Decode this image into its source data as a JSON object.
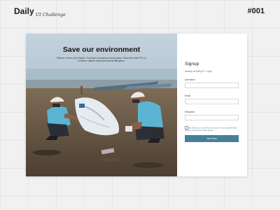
{
  "header": {
    "brand": "Daily",
    "brand_sub": "UI Challenge",
    "issue": "#001"
  },
  "hero": {
    "title": "Save our environment",
    "text": "Reduce, reuse, and recycle. Cut down on what you throw away. Follow the three 'R's' to conserve natural resources and landfill space."
  },
  "signup": {
    "title": "Signup",
    "already_text": "Already on Daily UI ?",
    "login_link": "Login",
    "fields": {
      "username": "Username",
      "email": "Email",
      "password": "Password"
    },
    "terms_prefix": "By clicking on Join Now you agree to our ",
    "terms_link": "agreements, privacy policy and cookie policy",
    "terms_suffix": ".",
    "join_label": "Join Now"
  },
  "colors": {
    "accent": "#477f9b",
    "link": "#3f7fa3",
    "page_bg": "#f1f1f1"
  }
}
